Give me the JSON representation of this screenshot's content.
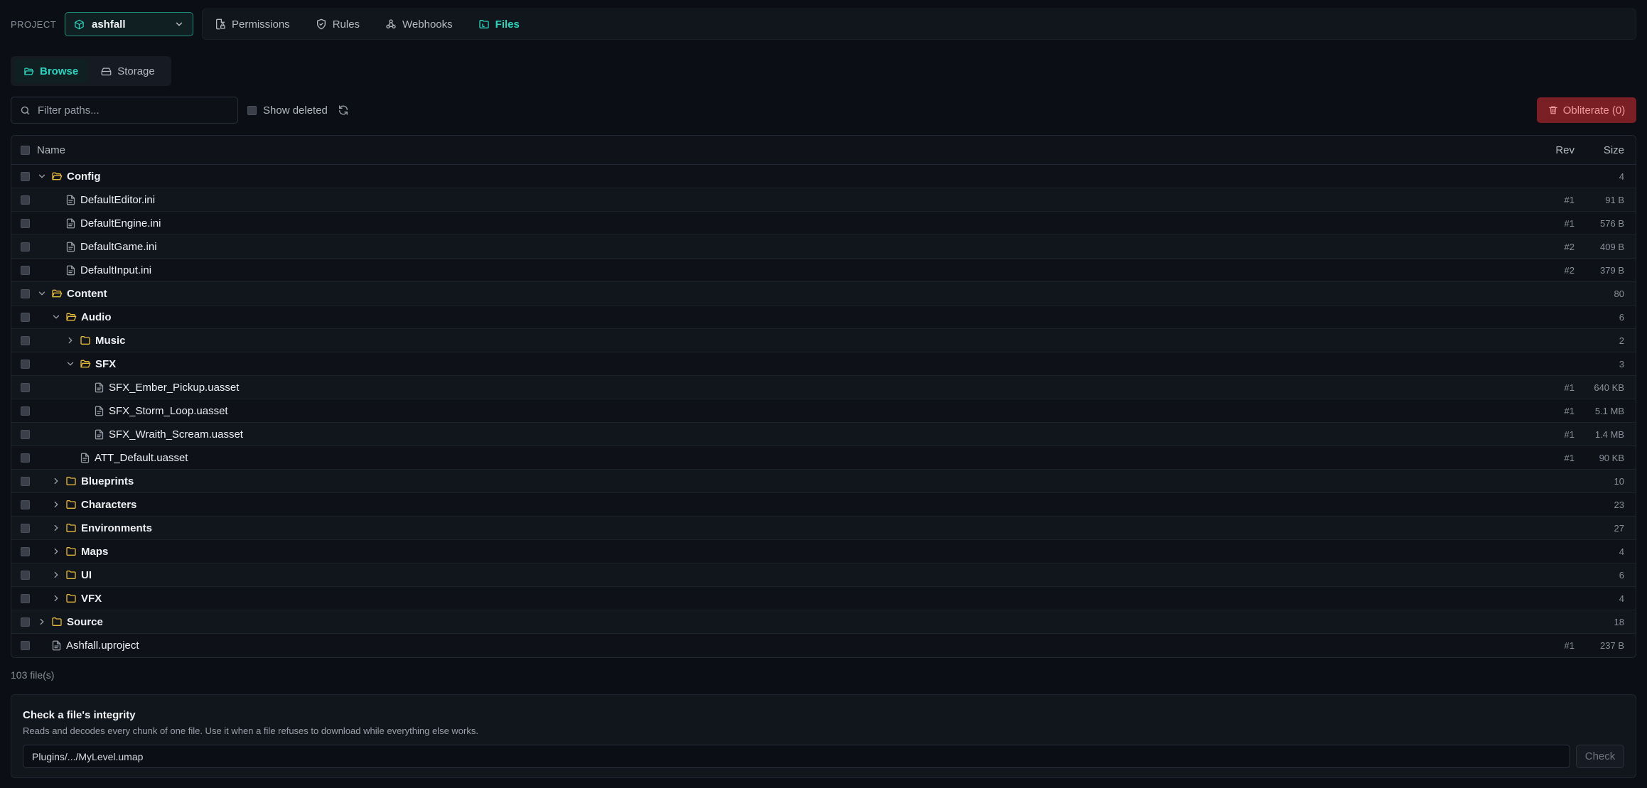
{
  "topbar": {
    "project_label": "PROJECT",
    "project_name": "ashfall",
    "tabs": [
      {
        "label": "Permissions",
        "icon": "file-lock-icon",
        "active": false
      },
      {
        "label": "Rules",
        "icon": "shield-icon",
        "active": false
      },
      {
        "label": "Webhooks",
        "icon": "webhook-icon",
        "active": false
      },
      {
        "label": "Files",
        "icon": "folder-tree-icon",
        "active": true
      }
    ]
  },
  "subtabs": [
    {
      "label": "Browse",
      "icon": "folder-open-icon",
      "active": true
    },
    {
      "label": "Storage",
      "icon": "hard-drive-icon",
      "active": false
    }
  ],
  "toolbar": {
    "filter_placeholder": "Filter paths...",
    "show_deleted_label": "Show deleted",
    "obliterate_label": "Obliterate (0)"
  },
  "table": {
    "headers": {
      "name": "Name",
      "rev": "Rev",
      "size": "Size"
    },
    "rows": [
      {
        "type": "folder",
        "depth": 0,
        "expanded": true,
        "name": "Config",
        "rev": "",
        "size": "4"
      },
      {
        "type": "file",
        "depth": 1,
        "name": "DefaultEditor.ini",
        "rev": "#1",
        "size": "91 B"
      },
      {
        "type": "file",
        "depth": 1,
        "name": "DefaultEngine.ini",
        "rev": "#1",
        "size": "576 B"
      },
      {
        "type": "file",
        "depth": 1,
        "name": "DefaultGame.ini",
        "rev": "#2",
        "size": "409 B"
      },
      {
        "type": "file",
        "depth": 1,
        "name": "DefaultInput.ini",
        "rev": "#2",
        "size": "379 B"
      },
      {
        "type": "folder",
        "depth": 0,
        "expanded": true,
        "name": "Content",
        "rev": "",
        "size": "80"
      },
      {
        "type": "folder",
        "depth": 1,
        "expanded": true,
        "name": "Audio",
        "rev": "",
        "size": "6"
      },
      {
        "type": "folder",
        "depth": 2,
        "expanded": false,
        "name": "Music",
        "rev": "",
        "size": "2"
      },
      {
        "type": "folder",
        "depth": 2,
        "expanded": true,
        "name": "SFX",
        "rev": "",
        "size": "3"
      },
      {
        "type": "file",
        "depth": 3,
        "name": "SFX_Ember_Pickup.uasset",
        "rev": "#1",
        "size": "640 KB"
      },
      {
        "type": "file",
        "depth": 3,
        "name": "SFX_Storm_Loop.uasset",
        "rev": "#1",
        "size": "5.1 MB"
      },
      {
        "type": "file",
        "depth": 3,
        "name": "SFX_Wraith_Scream.uasset",
        "rev": "#1",
        "size": "1.4 MB"
      },
      {
        "type": "file",
        "depth": 2,
        "name": "ATT_Default.uasset",
        "rev": "#1",
        "size": "90 KB"
      },
      {
        "type": "folder",
        "depth": 1,
        "expanded": false,
        "name": "Blueprints",
        "rev": "",
        "size": "10"
      },
      {
        "type": "folder",
        "depth": 1,
        "expanded": false,
        "name": "Characters",
        "rev": "",
        "size": "23"
      },
      {
        "type": "folder",
        "depth": 1,
        "expanded": false,
        "name": "Environments",
        "rev": "",
        "size": "27"
      },
      {
        "type": "folder",
        "depth": 1,
        "expanded": false,
        "name": "Maps",
        "rev": "",
        "size": "4"
      },
      {
        "type": "folder",
        "depth": 1,
        "expanded": false,
        "name": "UI",
        "rev": "",
        "size": "6"
      },
      {
        "type": "folder",
        "depth": 1,
        "expanded": false,
        "name": "VFX",
        "rev": "",
        "size": "4"
      },
      {
        "type": "folder",
        "depth": 0,
        "expanded": false,
        "name": "Source",
        "rev": "",
        "size": "18"
      },
      {
        "type": "file",
        "depth": 0,
        "name": "Ashfall.uproject",
        "rev": "#1",
        "size": "237 B"
      }
    ]
  },
  "file_count": "103 file(s)",
  "integrity": {
    "title": "Check a file's integrity",
    "description": "Reads and decodes every chunk of one file. Use it when a file refuses to download while everything else works.",
    "input_value": "Plugins/.../MyLevel.umap",
    "check_label": "Check"
  },
  "colors": {
    "accent": "#2dd4bf",
    "folder": "#e5b93c",
    "danger": "#7a1f24"
  }
}
